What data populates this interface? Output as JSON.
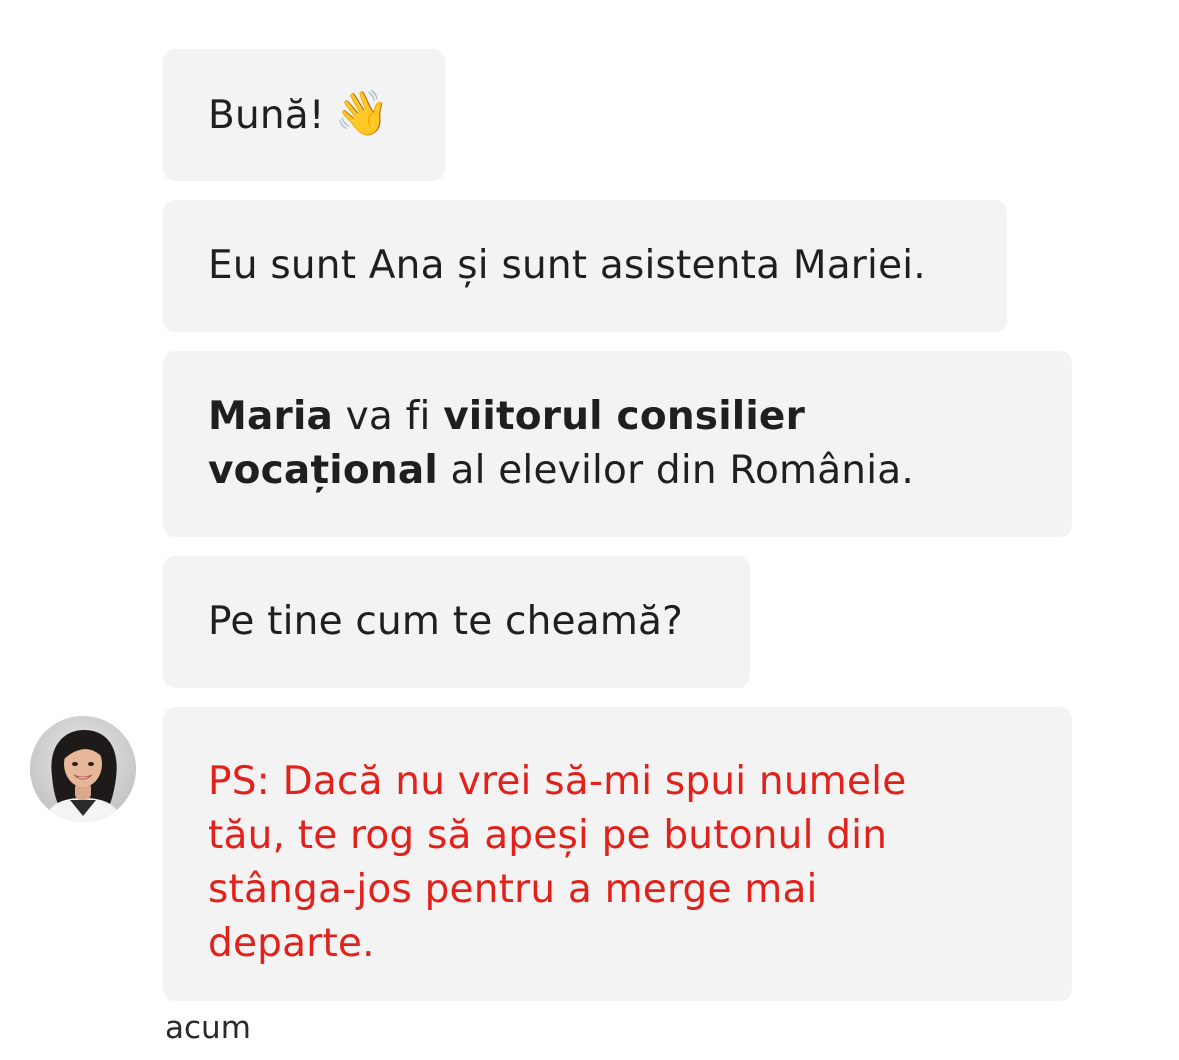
{
  "messages": [
    {
      "text": "Bună!",
      "emoji": "👋"
    },
    {
      "text": "Eu sunt Ana și sunt asistenta Mariei."
    },
    {
      "p1": "Maria",
      "p2": " va fi ",
      "p3": "viitorul consilier",
      "p4": "vocațional",
      "p5": " al elevilor din România."
    },
    {
      "text": "Pe tine cum te cheamă?"
    },
    {
      "line1": "PS: Dacă nu vrei să-mi spui numele",
      "line2": "tău, te rog să apeși pe butonul din",
      "line3": "stânga-jos pentru a merge mai",
      "line4": "departe."
    }
  ],
  "timestamp": "acum",
  "avatar_icon": "assistant-avatar",
  "colors": {
    "bubble": "#f3f3f3",
    "text": "#1f1f1f",
    "warning": "#e3211b"
  }
}
